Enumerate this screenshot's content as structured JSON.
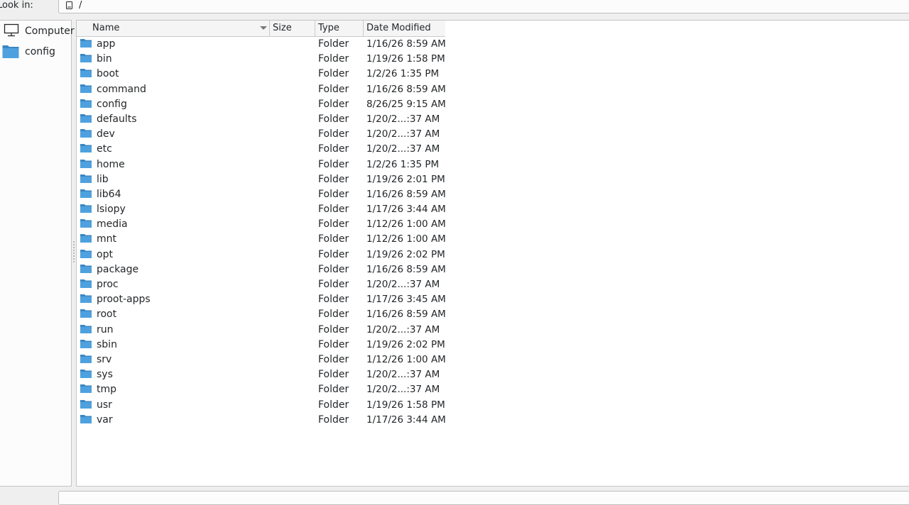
{
  "lookin": {
    "label": "Look in:",
    "path": "/"
  },
  "sidebar": {
    "items": [
      {
        "label": "Computer",
        "icon": "computer-icon"
      },
      {
        "label": "config",
        "icon": "folder-icon"
      }
    ]
  },
  "columns": {
    "name": "Name",
    "size": "Size",
    "type": "Type",
    "date": "Date Modified",
    "sort": "descending-on-name"
  },
  "files": [
    {
      "name": "app",
      "size": "",
      "type": "Folder",
      "date": "1/16/26 8:59 AM"
    },
    {
      "name": "bin",
      "size": "",
      "type": "Folder",
      "date": "1/19/26 1:58 PM"
    },
    {
      "name": "boot",
      "size": "",
      "type": "Folder",
      "date": "1/2/26 1:35 PM"
    },
    {
      "name": "command",
      "size": "",
      "type": "Folder",
      "date": "1/16/26 8:59 AM"
    },
    {
      "name": "config",
      "size": "",
      "type": "Folder",
      "date": "8/26/25 9:15 AM"
    },
    {
      "name": "defaults",
      "size": "",
      "type": "Folder",
      "date": "1/20/2...:37 AM"
    },
    {
      "name": "dev",
      "size": "",
      "type": "Folder",
      "date": "1/20/2...:37 AM"
    },
    {
      "name": "etc",
      "size": "",
      "type": "Folder",
      "date": "1/20/2...:37 AM"
    },
    {
      "name": "home",
      "size": "",
      "type": "Folder",
      "date": "1/2/26 1:35 PM"
    },
    {
      "name": "lib",
      "size": "",
      "type": "Folder",
      "date": "1/19/26 2:01 PM"
    },
    {
      "name": "lib64",
      "size": "",
      "type": "Folder",
      "date": "1/16/26 8:59 AM"
    },
    {
      "name": "lsiopy",
      "size": "",
      "type": "Folder",
      "date": "1/17/26 3:44 AM"
    },
    {
      "name": "media",
      "size": "",
      "type": "Folder",
      "date": "1/12/26 1:00 AM"
    },
    {
      "name": "mnt",
      "size": "",
      "type": "Folder",
      "date": "1/12/26 1:00 AM"
    },
    {
      "name": "opt",
      "size": "",
      "type": "Folder",
      "date": "1/19/26 2:02 PM"
    },
    {
      "name": "package",
      "size": "",
      "type": "Folder",
      "date": "1/16/26 8:59 AM"
    },
    {
      "name": "proc",
      "size": "",
      "type": "Folder",
      "date": "1/20/2...:37 AM"
    },
    {
      "name": "proot-apps",
      "size": "",
      "type": "Folder",
      "date": "1/17/26 3:45 AM"
    },
    {
      "name": "root",
      "size": "",
      "type": "Folder",
      "date": "1/16/26 8:59 AM"
    },
    {
      "name": "run",
      "size": "",
      "type": "Folder",
      "date": "1/20/2...:37 AM"
    },
    {
      "name": "sbin",
      "size": "",
      "type": "Folder",
      "date": "1/19/26 2:02 PM"
    },
    {
      "name": "srv",
      "size": "",
      "type": "Folder",
      "date": "1/12/26 1:00 AM"
    },
    {
      "name": "sys",
      "size": "",
      "type": "Folder",
      "date": "1/20/2...:37 AM"
    },
    {
      "name": "tmp",
      "size": "",
      "type": "Folder",
      "date": "1/20/2...:37 AM"
    },
    {
      "name": "usr",
      "size": "",
      "type": "Folder",
      "date": "1/19/26 1:58 PM"
    },
    {
      "name": "var",
      "size": "",
      "type": "Folder",
      "date": "1/17/26 3:44 AM"
    }
  ],
  "colors": {
    "folder": "#4ea1de",
    "folder_dark": "#3a86c3",
    "border": "#c3c4c5"
  }
}
